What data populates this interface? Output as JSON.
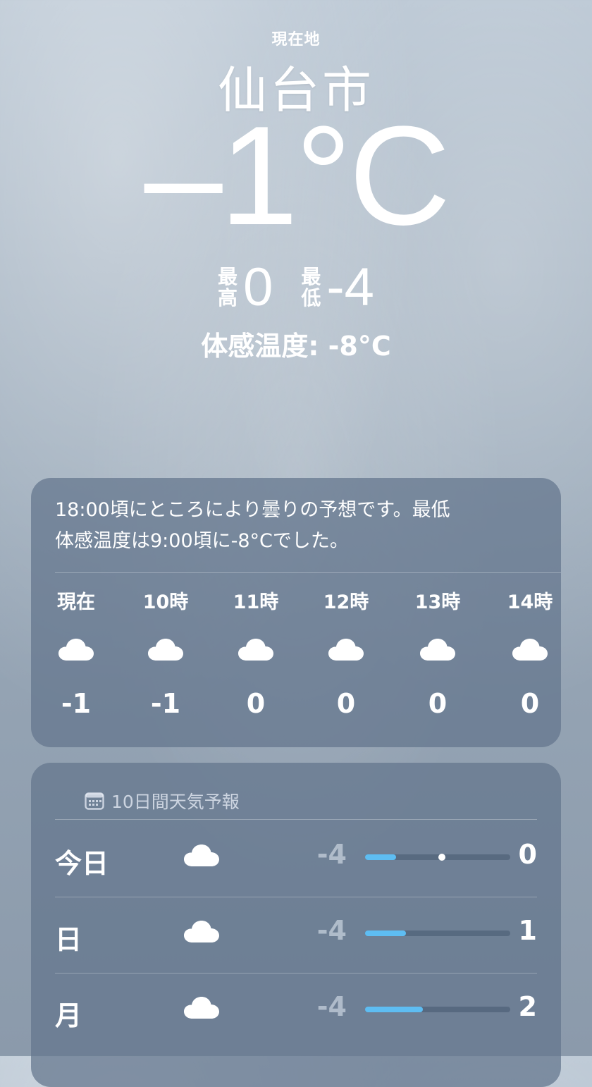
{
  "header": {
    "location_label": "現在地",
    "city": "仙台市",
    "temperature": "–1°C",
    "high_label": "最高",
    "high_label_chars": [
      "最",
      "高"
    ],
    "high_value": "0",
    "low_label": "最低",
    "low_label_chars": [
      "最",
      "低"
    ],
    "low_value": "-4",
    "feels_like": "体感温度: -8°C"
  },
  "hourly": {
    "summary": "18:00頃にところにより曇りの予想です。最低体感温度は9:00頃に-8°Cでした。",
    "summary_line1": "18:00頃にところにより曇りの予想です。最低",
    "summary_line2": "体感温度は9:00頃に-8°Cでした。",
    "hours": [
      {
        "label": "現在",
        "icon": "cloud-icon",
        "temp": "-1"
      },
      {
        "label": "10時",
        "icon": "cloud-icon",
        "temp": "-1"
      },
      {
        "label": "11時",
        "icon": "cloud-icon",
        "temp": "0"
      },
      {
        "label": "12時",
        "icon": "cloud-icon",
        "temp": "0"
      },
      {
        "label": "13時",
        "icon": "cloud-icon",
        "temp": "0"
      },
      {
        "label": "14時",
        "icon": "cloud-icon",
        "temp": "0"
      }
    ]
  },
  "forecast": {
    "title": "10日間天気予報",
    "title_icon": "calendar-icon",
    "range_min": -4,
    "range_max": 2,
    "current_temp": -1,
    "days": [
      {
        "day": "今日",
        "icon": "cloud-icon",
        "low": "-4",
        "high": "0",
        "low_value": -4,
        "high_value": 0,
        "show_current": true
      },
      {
        "day": "日",
        "icon": "cloud-icon",
        "low": "-4",
        "high": "1",
        "low_value": -4,
        "high_value": 1,
        "show_current": false
      },
      {
        "day": "月",
        "icon": "cloud-icon",
        "low": "-4",
        "high": "2",
        "low_value": -4,
        "high_value": 2,
        "show_current": false
      }
    ]
  },
  "colors": {
    "card_bg": "#62748c",
    "bar_fill": "#5ebdf2",
    "bar_track": "#465870"
  }
}
